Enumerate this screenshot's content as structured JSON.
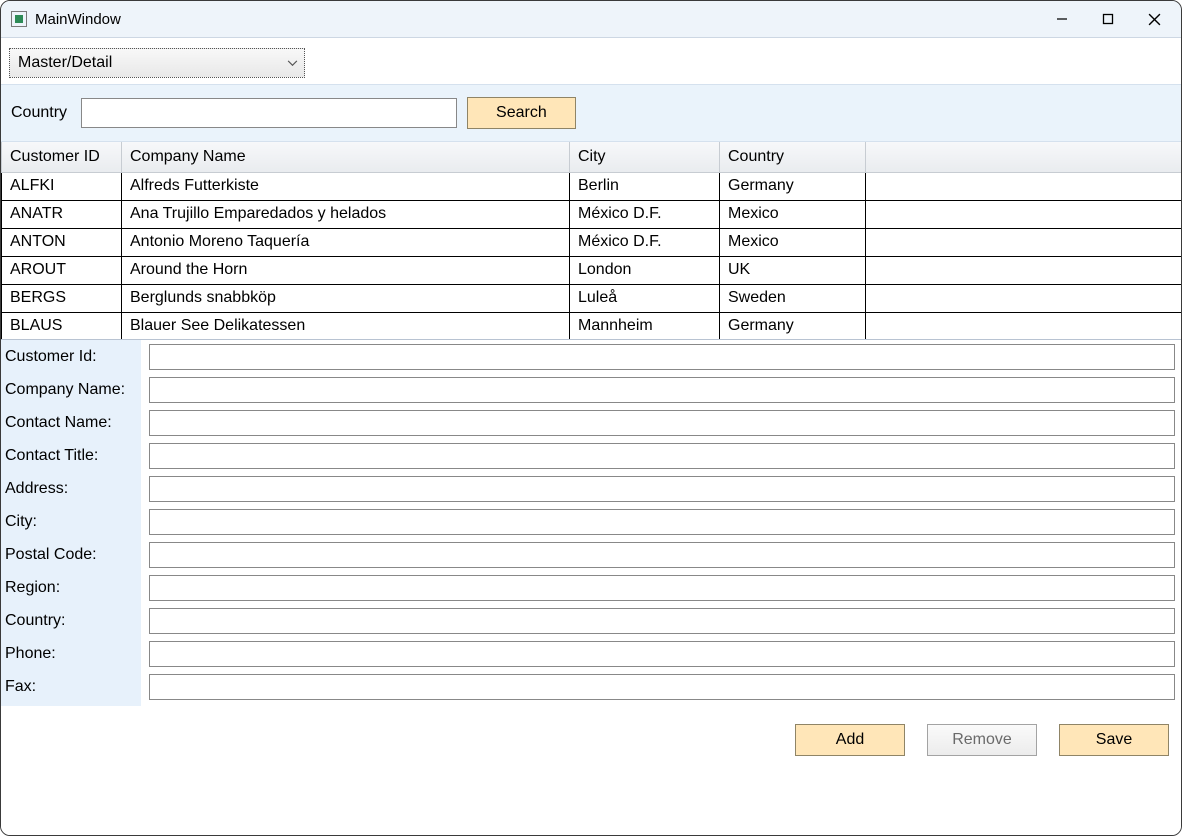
{
  "window": {
    "title": "MainWindow"
  },
  "combo": {
    "selected": "Master/Detail"
  },
  "search": {
    "label": "Country",
    "value": "",
    "button": "Search"
  },
  "grid": {
    "columns": [
      "Customer ID",
      "Company Name",
      "City",
      "Country",
      ""
    ],
    "rows": [
      {
        "id": "ALFKI",
        "company": "Alfreds Futterkiste",
        "city": "Berlin",
        "country": "Germany"
      },
      {
        "id": "ANATR",
        "company": "Ana Trujillo Emparedados y helados",
        "city": "México D.F.",
        "country": "Mexico"
      },
      {
        "id": "ANTON",
        "company": "Antonio Moreno Taquería",
        "city": "México D.F.",
        "country": "Mexico"
      },
      {
        "id": "AROUT",
        "company": "Around the Horn",
        "city": "London",
        "country": "UK"
      },
      {
        "id": "BERGS",
        "company": "Berglunds snabbköp",
        "city": "Luleå",
        "country": "Sweden"
      },
      {
        "id": "BLAUS",
        "company": "Blauer See Delikatessen",
        "city": "Mannheim",
        "country": "Germany"
      }
    ]
  },
  "form": {
    "fields": [
      {
        "label": "Customer Id:",
        "value": ""
      },
      {
        "label": "Company Name:",
        "value": ""
      },
      {
        "label": "Contact Name:",
        "value": ""
      },
      {
        "label": "Contact Title:",
        "value": ""
      },
      {
        "label": "Address:",
        "value": ""
      },
      {
        "label": "City:",
        "value": ""
      },
      {
        "label": "Postal Code:",
        "value": ""
      },
      {
        "label": "Region:",
        "value": ""
      },
      {
        "label": "Country:",
        "value": ""
      },
      {
        "label": "Phone:",
        "value": ""
      },
      {
        "label": "Fax:",
        "value": ""
      }
    ]
  },
  "buttons": {
    "add": "Add",
    "remove": "Remove",
    "save": "Save"
  }
}
